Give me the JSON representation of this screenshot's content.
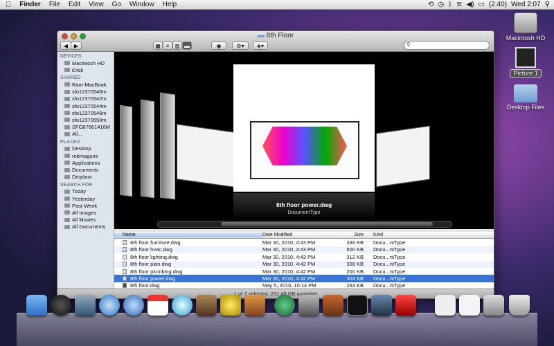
{
  "menubar": {
    "apple": "",
    "items": [
      "Finder",
      "File",
      "Edit",
      "View",
      "Go",
      "Window",
      "Help"
    ],
    "battery": "(2:40)",
    "clock": "Wed 2:07"
  },
  "desktop": {
    "icons": [
      "Macintosh HD",
      "Picture 1",
      "Desktop Files"
    ]
  },
  "window": {
    "title": "8th Floor",
    "search_placeholder": "",
    "status": "1 of 7 selected, 251.48 GB available"
  },
  "sidebar": [
    {
      "header": "DEVICES",
      "items": [
        "Macintosh HD",
        "iDisk"
      ]
    },
    {
      "header": "SHARED",
      "items": [
        "Ram-MacBook",
        "sfo12370540m",
        "sfo12370542m",
        "sfo12370544m",
        "sfo12370546m",
        "sfo12370550m",
        "SFO87661416M",
        "All..."
      ]
    },
    {
      "header": "PLACES",
      "items": [
        "Desktop",
        "robmaguire",
        "Applications",
        "Documents",
        "Dropbox"
      ]
    },
    {
      "header": "SEARCH FOR",
      "items": [
        "Today",
        "Yesterday",
        "Past Week",
        "All Images",
        "All Movies",
        "All Documents"
      ]
    }
  ],
  "coverflow": {
    "name": "8th floor power.dwg",
    "kind": "DocumentType"
  },
  "columns": {
    "name": "Name",
    "date": "Date Modified",
    "size": "Size",
    "kind": "Kind"
  },
  "files": [
    {
      "name": "8th floor furniture.dwg",
      "date": "Mar 30, 2010, 4:43 PM",
      "size": "336 KB",
      "kind": "Docu...ntType"
    },
    {
      "name": "8th floor hvac.dwg",
      "date": "Mar 30, 2010, 4:43 PM",
      "size": "500 KB",
      "kind": "Docu...ntType"
    },
    {
      "name": "8th floor lighting.dwg",
      "date": "Mar 30, 2010, 4:43 PM",
      "size": "312 KB",
      "kind": "Docu...ntType"
    },
    {
      "name": "8th floor plan.dwg",
      "date": "Mar 30, 2010, 4:42 PM",
      "size": "308 KB",
      "kind": "Docu...ntType"
    },
    {
      "name": "8th floor plumbing.dwg",
      "date": "Mar 30, 2010, 4:42 PM",
      "size": "200 KB",
      "kind": "Docu...ntType"
    },
    {
      "name": "8th floor power.dwg",
      "date": "Mar 30, 2010, 4:42 PM",
      "size": "304 KB",
      "kind": "Docu...ntType"
    },
    {
      "name": "8th floor.dwg",
      "date": "May 5, 2010, 10:14 PM",
      "size": "264 KB",
      "kind": "Docu...ntType"
    }
  ],
  "selected_index": 5,
  "dock": [
    "finder-icon",
    "dashboard-icon",
    "mail-icon",
    "safari-icon",
    "ichat-icon",
    "ical-icon",
    "itunes-icon",
    "iphoto-icon",
    "imovie-icon",
    "garageband-icon",
    "time-machine-icon",
    "system-preferences-icon",
    "keynote-icon",
    "terminal-icon",
    "spaces-icon",
    "acrobat-icon",
    "documents-stack-icon",
    "downloads-stack-icon",
    "network-icon",
    "trash-icon"
  ]
}
